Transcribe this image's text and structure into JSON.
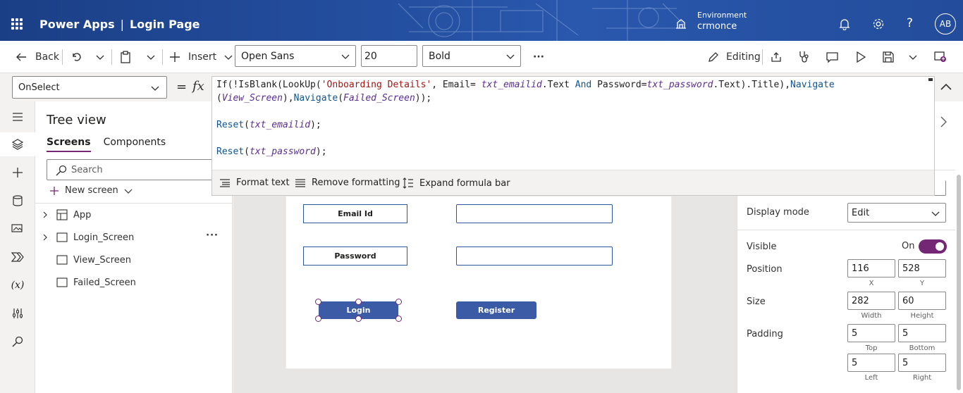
{
  "header": {
    "app_name": "Power Apps",
    "separator": "|",
    "page_name": "Login Page",
    "environment_label": "Environment",
    "environment_value": "crmonce",
    "help_glyph": "?",
    "avatar_initials": "AB",
    "icons": [
      "waffle-icon",
      "environment-icon",
      "bell-icon",
      "gear-icon",
      "help-icon"
    ]
  },
  "commandbar": {
    "back_label": "Back",
    "insert_label": "Insert",
    "font_value": "Open Sans",
    "font_size_value": "20",
    "font_weight_value": "Bold",
    "more_label": "···",
    "editing_label": "Editing"
  },
  "formula_bar": {
    "property": "OnSelect",
    "equals": "=",
    "fx": "fx",
    "tools": {
      "format_text": "Format text",
      "remove_formatting": "Remove formatting",
      "expand_formula_bar": "Expand formula bar"
    }
  },
  "formula": {
    "l1_a": "If(!IsBlank(LookUp(",
    "l1_str": "'Onboarding Details'",
    "l1_b": ", Email= ",
    "l1_ctl1": "txt_emailid",
    "l1_c": ".Text ",
    "l1_and": "And",
    "l1_d": " Password=",
    "l1_ctl2": "txt_password",
    "l1_e": ".Text).Title),",
    "l1_nav": "Navigate",
    "l2_a": "(",
    "l2_ctl1": "View_Screen",
    "l2_b": "),",
    "l2_nav": "Navigate",
    "l2_c": "(",
    "l2_ctl2": "Failed_Screen",
    "l2_d": "));",
    "l3_fn": "Reset",
    "l3_a": "(",
    "l3_ctl": "txt_emailid",
    "l3_b": ");",
    "l4_fn": "Reset",
    "l4_a": "(",
    "l4_ctl": "txt_password",
    "l4_b": ");"
  },
  "tree": {
    "title": "Tree view",
    "tab_screens": "Screens",
    "tab_components": "Components",
    "search_placeholder": "Search",
    "new_screen": "New screen",
    "nodes": [
      "App",
      "Login_Screen",
      "View_Screen",
      "Failed_Screen"
    ],
    "more": "···"
  },
  "canvas": {
    "email_label": "Email Id",
    "password_label": "Password",
    "login_button": "Login",
    "register_button": "Register"
  },
  "properties": {
    "display_mode_label": "Display mode",
    "display_mode_value": "Edit",
    "visible_label": "Visible",
    "visible_value": "On",
    "position_label": "Position",
    "position_x": "116",
    "position_y": "528",
    "x_sub": "X",
    "y_sub": "Y",
    "size_label": "Size",
    "width": "282",
    "height": "60",
    "width_sub": "Width",
    "height_sub": "Height",
    "padding_label": "Padding",
    "pad_top": "5",
    "pad_bottom": "5",
    "pad_left": "5",
    "pad_right": "5",
    "top_sub": "Top",
    "bottom_sub": "Bottom",
    "left_sub": "Left",
    "right_sub": "Right"
  },
  "colors": {
    "brand_purple": "#742774",
    "header_blue": "#244fa0",
    "button_blue": "#3b5ba7"
  }
}
